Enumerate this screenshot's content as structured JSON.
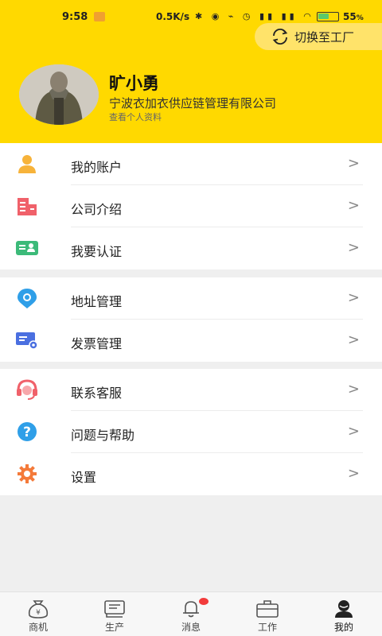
{
  "statusbar": {
    "time": "9:58",
    "network_speed": "0.5K/s",
    "battery_percent": "55",
    "battery_suffix": "%",
    "battery_level": 0.55
  },
  "header": {
    "switch_label": "切换至工厂",
    "user_name": "旷小勇",
    "company": "宁波衣加衣供应链管理有限公司",
    "profile_link": "查看个人资料"
  },
  "menu": {
    "group1": [
      {
        "label": "我的账户",
        "icon": "user-icon"
      },
      {
        "label": "公司介绍",
        "icon": "building-icon"
      },
      {
        "label": "我要认证",
        "icon": "id-card-icon"
      }
    ],
    "group2": [
      {
        "label": "地址管理",
        "icon": "location-icon"
      },
      {
        "label": "发票管理",
        "icon": "invoice-icon"
      }
    ],
    "group3": [
      {
        "label": "联系客服",
        "icon": "headset-icon"
      },
      {
        "label": "问题与帮助",
        "icon": "help-icon"
      },
      {
        "label": "设置",
        "icon": "gear-icon"
      }
    ],
    "chevron": ">"
  },
  "tabs": [
    {
      "label": "商机",
      "icon": "money-bag-icon"
    },
    {
      "label": "生产",
      "icon": "production-icon"
    },
    {
      "label": "消息",
      "icon": "bell-icon"
    },
    {
      "label": "工作",
      "icon": "briefcase-icon"
    },
    {
      "label": "我的",
      "icon": "user-tab-icon"
    }
  ],
  "colors": {
    "brand_yellow": "#ffd900",
    "badge_red": "#f23b3b"
  }
}
